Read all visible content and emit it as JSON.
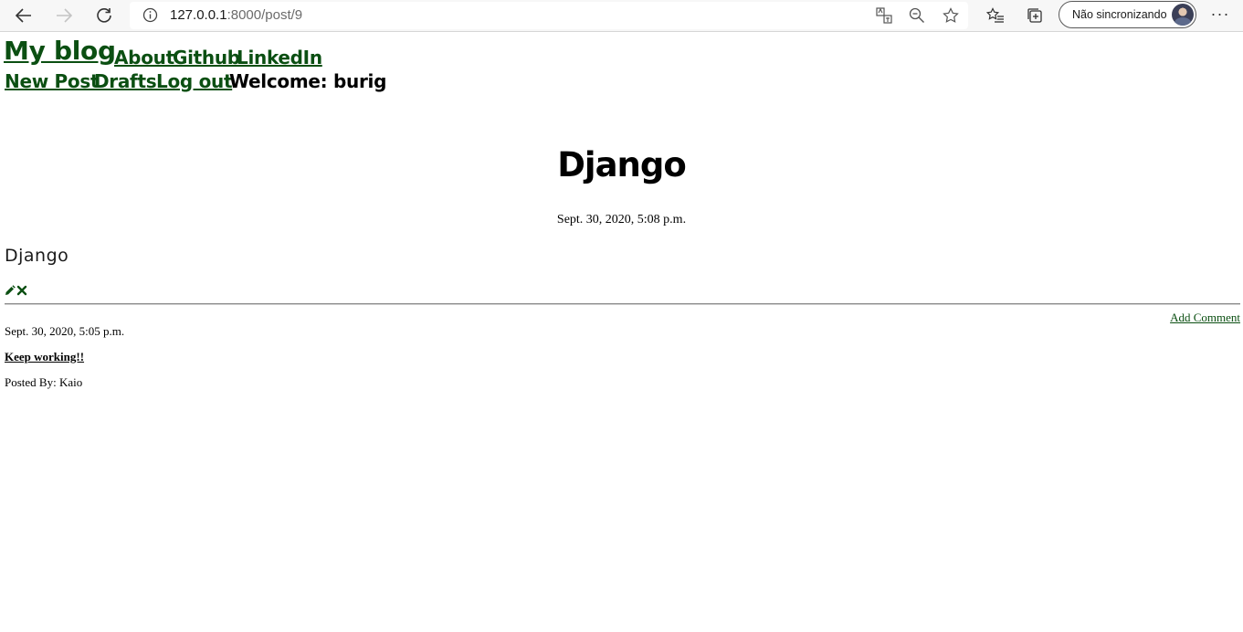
{
  "browser": {
    "url_host": "127.0.0.1",
    "url_path": ":8000/post/9",
    "sync_label": "Não sincronizando",
    "more_label": "···"
  },
  "site": {
    "brand": "My blog",
    "nav": [
      "About",
      "Github",
      "LinkedIn"
    ],
    "user_nav": [
      "New Post",
      "Drafts",
      "Log out"
    ],
    "welcome": "Welcome: burig"
  },
  "post": {
    "title": "Django",
    "date": "Sept. 30, 2020, 5:08 p.m.",
    "body": "Django"
  },
  "actions": {
    "add_comment": "Add Comment"
  },
  "comment": {
    "date": "Sept. 30, 2020, 5:05 p.m.",
    "text": "Keep working!!",
    "author": "Posted By: Kaio"
  },
  "colors": {
    "link": "#0b4f12",
    "text": "#000000"
  },
  "icons": [
    "back-arrow-icon",
    "forward-arrow-icon",
    "refresh-icon",
    "info-icon",
    "translate-icon",
    "zoom-icon",
    "star-icon",
    "favorites-icon",
    "collections-icon",
    "pencil-icon",
    "delete-x-icon"
  ]
}
